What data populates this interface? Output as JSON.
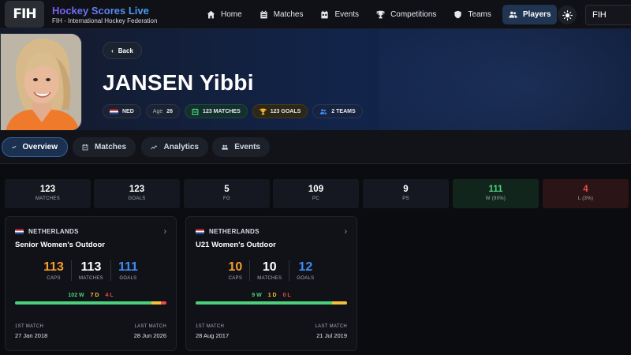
{
  "app": {
    "logo_text": "FIH",
    "title": "Hockey Scores Live",
    "subtitle": "FIH - International Hockey Federation"
  },
  "nav": {
    "items": [
      {
        "label": "Home",
        "icon": "home-icon"
      },
      {
        "label": "Matches",
        "icon": "calendar-icon"
      },
      {
        "label": "Events",
        "icon": "calendar-icon"
      },
      {
        "label": "Competitions",
        "icon": "trophy-icon"
      },
      {
        "label": "Teams",
        "icon": "shield-icon"
      },
      {
        "label": "Players",
        "icon": "users-icon"
      }
    ],
    "active": "Players",
    "search_value": "FIH"
  },
  "player": {
    "back_label": "Back",
    "name": "JANSEN Yibbi",
    "country": "NED",
    "age_label": "Age",
    "age": "26",
    "matches_chip": "123 MATCHES",
    "goals_chip": "123 GOALS",
    "teams_chip": "2 TEAMS"
  },
  "tabs": [
    {
      "label": "Overview",
      "icon": "trend-icon",
      "active": true
    },
    {
      "label": "Matches",
      "icon": "calendar-icon",
      "active": false
    },
    {
      "label": "Analytics",
      "icon": "analytics-icon",
      "active": false
    },
    {
      "label": "Events",
      "icon": "users-icon",
      "active": false
    }
  ],
  "stats": [
    {
      "value": "123",
      "label": "MATCHES"
    },
    {
      "value": "123",
      "label": "GOALS"
    },
    {
      "value": "5",
      "label": "FG"
    },
    {
      "value": "109",
      "label": "PC"
    },
    {
      "value": "9",
      "label": "PS"
    },
    {
      "value": "111",
      "label": "W (90%)"
    },
    {
      "value": "4",
      "label": "L (3%)"
    }
  ],
  "teams": [
    {
      "country": "NETHERLANDS",
      "name": "Senior Women's Outdoor",
      "caps": "113",
      "caps_label": "CAPS",
      "matches": "113",
      "matches_label": "MATCHES",
      "goals": "111",
      "goals_label": "GOALS",
      "w": "102 W",
      "d": "7 D",
      "l": "4 L",
      "w_frac": 0.903,
      "d_frac": 0.062,
      "l_frac": 0.035,
      "first_label": "1ST MATCH",
      "first": "27 Jan 2018",
      "last_label": "LAST MATCH",
      "last": "28 Jun 2026"
    },
    {
      "country": "NETHERLANDS",
      "name": "U21 Women's Outdoor",
      "caps": "10",
      "caps_label": "CAPS",
      "matches": "10",
      "matches_label": "MATCHES",
      "goals": "12",
      "goals_label": "GOALS",
      "w": "9 W",
      "d": "1 D",
      "l": "0 L",
      "w_frac": 0.9,
      "d_frac": 0.1,
      "l_frac": 0.0,
      "first_label": "1ST MATCH",
      "first": "28 Aug 2017",
      "last_label": "LAST MATCH",
      "last": "21 Jul 2019"
    }
  ],
  "colors": {
    "win": "#4cd17a",
    "draw": "#f3c13a",
    "loss": "#ef4a4a",
    "accent": "#3f8cf5"
  }
}
